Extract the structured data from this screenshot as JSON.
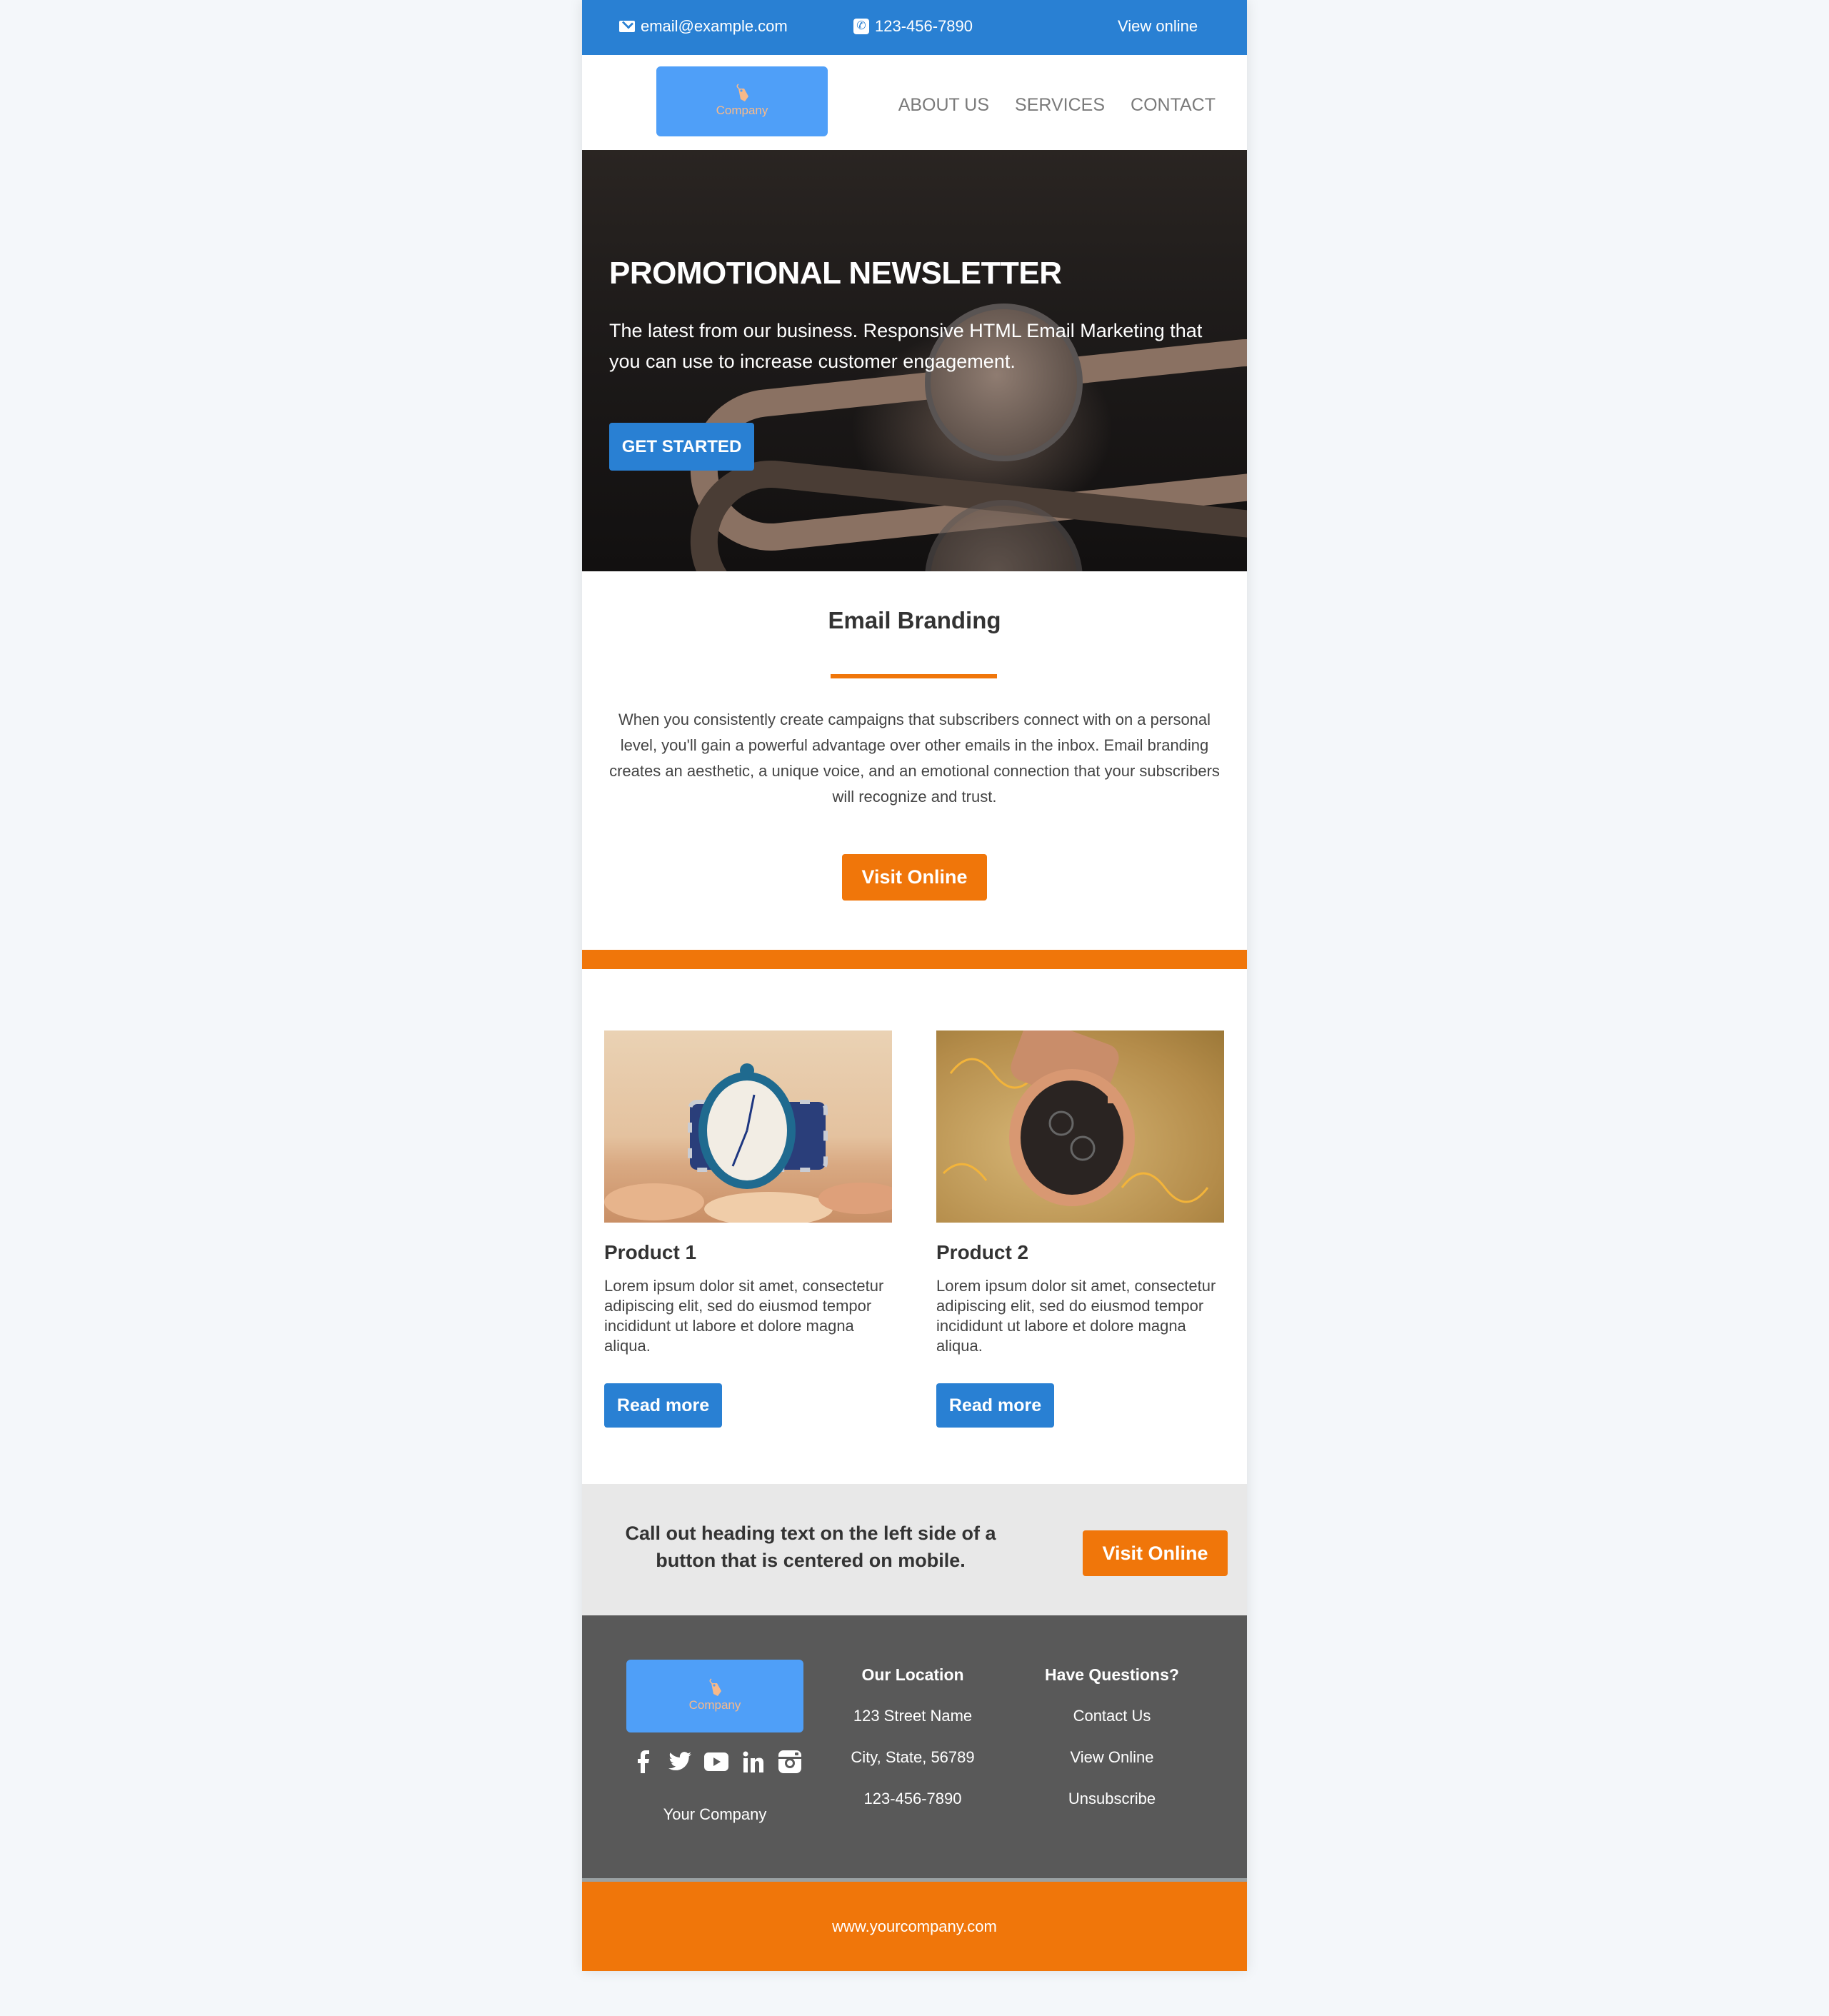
{
  "topbar": {
    "email": "email@example.com",
    "phone": "123-456-7890",
    "view_online": "View online"
  },
  "nav": {
    "logo_label": "Company",
    "links": [
      "ABOUT US",
      "SERVICES",
      "CONTACT"
    ]
  },
  "hero": {
    "title": "PROMOTIONAL NEWSLETTER",
    "subtitle": "The latest from our business. Responsive HTML Email Marketing that you can use to increase customer engagement.",
    "cta": "GET STARTED"
  },
  "branding": {
    "title": "Email Branding",
    "text": "When you consistently create campaigns that subscribers connect with on a personal level, you'll gain a powerful advantage over other emails in the inbox. Email branding creates an aesthetic, a unique voice, and an emotional connection that your subscribers will recognize and trust.",
    "button": "Visit Online"
  },
  "products": [
    {
      "title": "Product 1",
      "text": "Lorem ipsum dolor sit amet, consectetur adipiscing elit, sed do eiusmod tempor incididunt ut labore et dolore magna aliqua.",
      "button": "Read more"
    },
    {
      "title": "Product 2",
      "text": "Lorem ipsum dolor sit amet, consectetur adipiscing elit, sed do eiusmod tempor incididunt ut labore et dolore magna aliqua.",
      "button": "Read more"
    }
  ],
  "callout": {
    "text": "Call out heading text on the left side of a button that is centered on mobile.",
    "button": "Visit Online"
  },
  "footer": {
    "logo_label": "Company",
    "social": [
      "facebook",
      "twitter",
      "youtube",
      "linkedin",
      "instagram"
    ],
    "company": "Your Company",
    "location": {
      "heading": "Our Location",
      "lines": [
        "123 Street Name",
        "City, State, 56789",
        "123-456-7890"
      ]
    },
    "questions": {
      "heading": "Have Questions?",
      "links": [
        "Contact Us",
        "View Online",
        "Unsubscribe"
      ]
    },
    "website": "www.yourcompany.com"
  },
  "colors": {
    "primary_blue": "#2980d3",
    "logo_blue": "#4f9ff8",
    "accent_orange": "#f0760a",
    "footer_gray": "#595959",
    "callout_gray": "#e8e8e8"
  }
}
